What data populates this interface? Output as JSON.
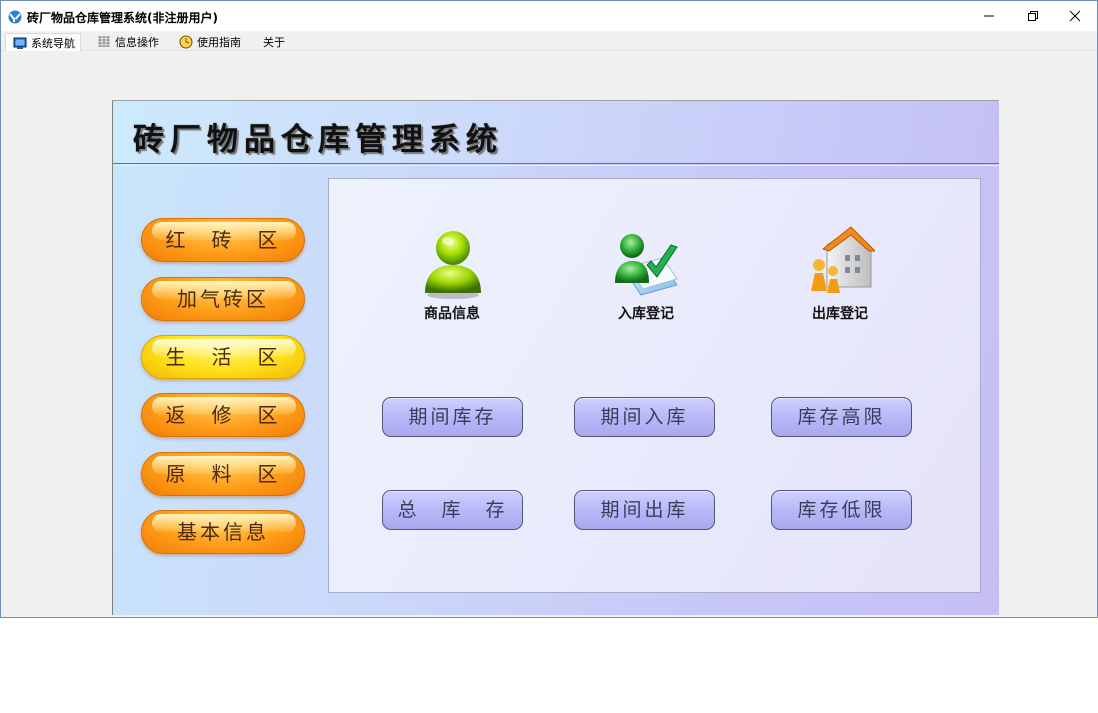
{
  "window": {
    "title": "砖厂物品仓库管理系统(非注册用户)"
  },
  "menu": {
    "items": [
      {
        "label": "系统导航",
        "icon": "monitor-icon"
      },
      {
        "label": "信息操作",
        "icon": "grid-icon"
      },
      {
        "label": "使用指南",
        "icon": "clock-icon"
      },
      {
        "label": "关于",
        "icon": ""
      }
    ]
  },
  "header": {
    "title": "砖厂物品仓库管理系统"
  },
  "left_nav": {
    "items": [
      {
        "label": "红　砖　区"
      },
      {
        "label": "加气砖区"
      },
      {
        "label": "生　活　区"
      },
      {
        "label": "返　修　区"
      },
      {
        "label": "原　料　区"
      },
      {
        "label": "基本信息"
      }
    ]
  },
  "tiles": {
    "items": [
      {
        "label": "商品信息",
        "icon": "user-icon"
      },
      {
        "label": "入库登记",
        "icon": "check-in-icon"
      },
      {
        "label": "出库登记",
        "icon": "house-exit-icon"
      }
    ]
  },
  "reports": {
    "row1": [
      {
        "label": "期间库存"
      },
      {
        "label": "期间入库"
      },
      {
        "label": "库存高限"
      }
    ],
    "row2": [
      {
        "label": "总　库　存"
      },
      {
        "label": "期间出库"
      },
      {
        "label": "库存低限"
      }
    ]
  },
  "colors": {
    "nav_orange": "#ff9f1a",
    "nav_yellow": "#ffe21a",
    "report_button": "#b6b6f7"
  }
}
